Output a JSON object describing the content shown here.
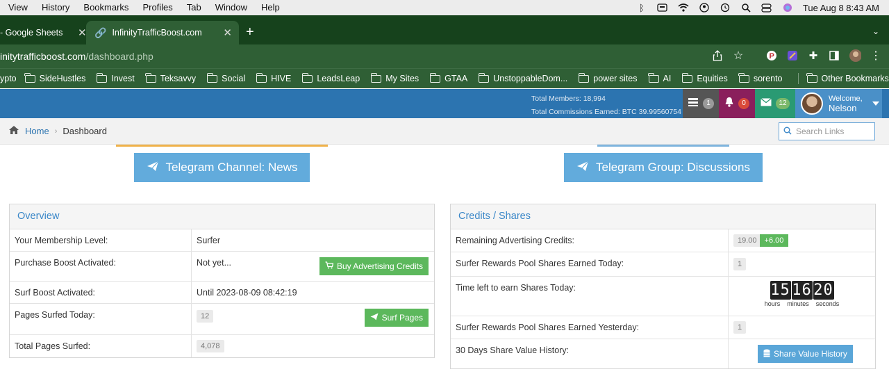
{
  "menubar": {
    "items": [
      "View",
      "History",
      "Bookmarks",
      "Profiles",
      "Tab",
      "Window",
      "Help"
    ],
    "datetime": "Tue Aug 8  8:43 AM"
  },
  "tabs": [
    {
      "title": "- Google Sheets",
      "active": false
    },
    {
      "title": "InfinityTrafficBoost.com",
      "active": true
    }
  ],
  "address": {
    "host": "initytrafficboost.com",
    "path": "/dashboard.php"
  },
  "bookmarks": [
    "ypto",
    "SideHustles",
    "Invest",
    "Teksavvy",
    "Social",
    "HIVE",
    "LeadsLeap",
    "My Sites",
    "GTAA",
    "UnstoppableDom...",
    "power sites",
    "AI",
    "Equities",
    "sorento"
  ],
  "other_bookmarks": "Other Bookmarks",
  "header": {
    "total_members": "Total Members: 18,994",
    "total_commissions": "Total Commissions Earned: BTC 39.99560754",
    "badges": {
      "tasks": "1",
      "alerts": "0",
      "messages": "12"
    },
    "welcome": "Welcome,",
    "username": "Nelson",
    "colors": {
      "header": "#2c74b0",
      "tasks_bg": "#555555",
      "alerts_bg": "#8a1f5c",
      "messages_bg": "#2a9a73"
    }
  },
  "breadcrumb": {
    "home": "Home",
    "current": "Dashboard"
  },
  "search": {
    "placeholder": "Search Links"
  },
  "telegram": {
    "channel": "Telegram Channel: News",
    "group": "Telegram Group: Discussions"
  },
  "overview": {
    "title": "Overview",
    "rows": [
      {
        "label": "Your Membership Level:",
        "value": "Surfer"
      },
      {
        "label": "Purchase Boost Activated:",
        "value": "Not yet...",
        "button": "Buy Advertising Credits"
      },
      {
        "label": "Surf Boost Activated:",
        "value": "Until 2023-08-09 08:42:19"
      },
      {
        "label": "Pages Surfed Today:",
        "value": "12",
        "button": "Surf Pages"
      },
      {
        "label": "Total Pages Surfed:",
        "value": "4,078"
      }
    ]
  },
  "credits": {
    "title": "Credits / Shares",
    "rows": [
      {
        "label": "Remaining Advertising Credits:",
        "value": "19.00",
        "extra": "+6.00"
      },
      {
        "label": "Surfer Rewards Pool Shares Earned Today:",
        "value": "1"
      },
      {
        "label": "Time left to earn Shares Today:",
        "countdown": {
          "hours": "15",
          "minutes": "16",
          "seconds": "20",
          "labels": [
            "hours",
            "minutes",
            "seconds"
          ]
        }
      },
      {
        "label": "Surfer Rewards Pool Shares Earned Yesterday:",
        "value": "1"
      },
      {
        "label": "30 Days Share Value History:",
        "button": "Share Value History"
      }
    ]
  }
}
